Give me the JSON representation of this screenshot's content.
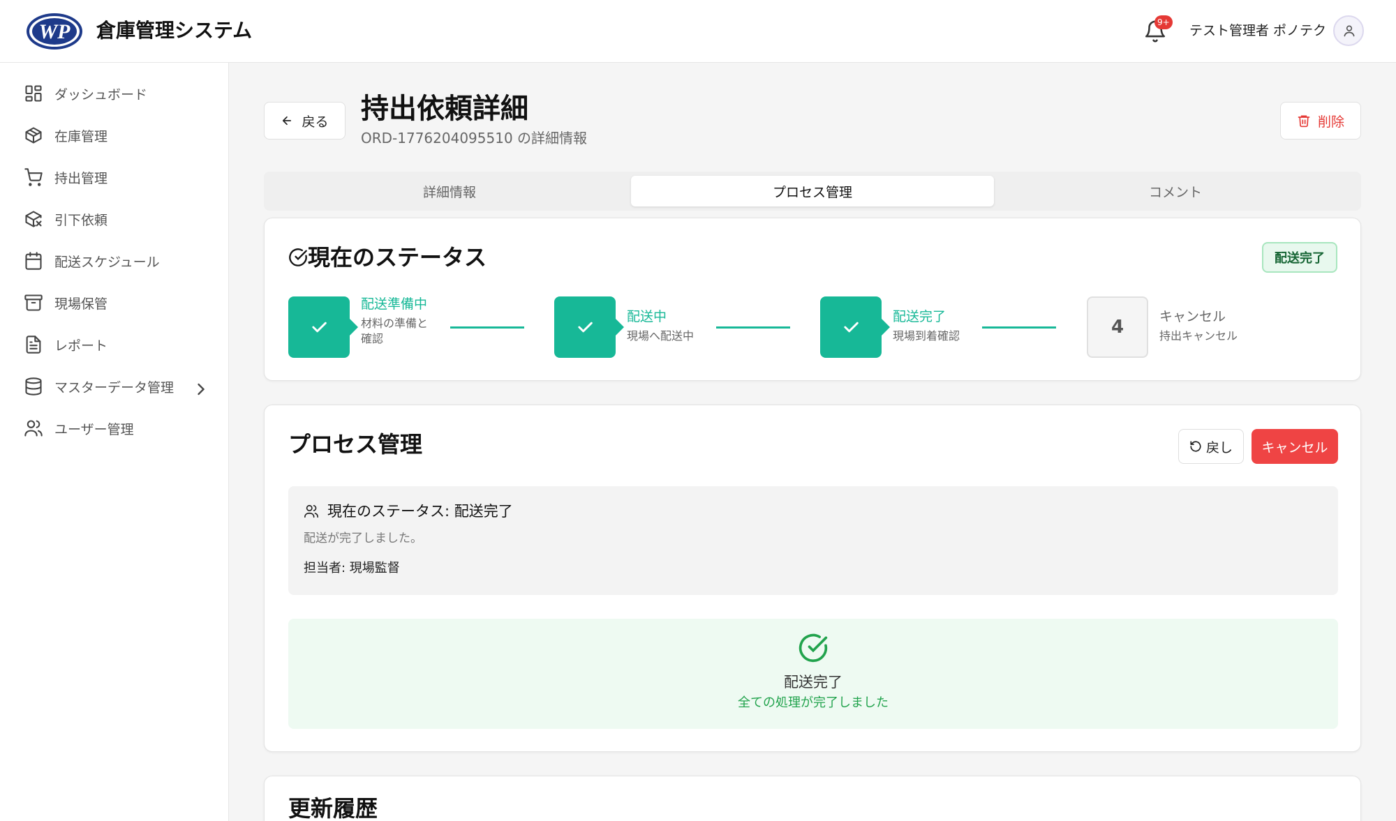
{
  "header": {
    "app_title": "倉庫管理システム",
    "notification_badge": "9+",
    "user_name": "テスト管理者 ポノテク"
  },
  "sidebar": {
    "items": [
      {
        "label": "ダッシュボード",
        "icon": "dashboard-icon"
      },
      {
        "label": "在庫管理",
        "icon": "box-icon"
      },
      {
        "label": "持出管理",
        "icon": "cart-icon"
      },
      {
        "label": "引下依頼",
        "icon": "package-return-icon"
      },
      {
        "label": "配送スケジュール",
        "icon": "calendar-icon"
      },
      {
        "label": "現場保管",
        "icon": "archive-icon"
      },
      {
        "label": "レポート",
        "icon": "document-icon"
      },
      {
        "label": "マスターデータ管理",
        "icon": "database-icon"
      },
      {
        "label": "ユーザー管理",
        "icon": "users-icon"
      }
    ]
  },
  "page": {
    "back_label": "戻る",
    "title": "持出依頼詳細",
    "subtitle": "ORD-1776204095510 の詳細情報",
    "delete_label": "削除"
  },
  "tabs": [
    {
      "label": "詳細情報",
      "active": false
    },
    {
      "label": "プロセス管理",
      "active": true
    },
    {
      "label": "コメント",
      "active": false
    }
  ],
  "status_card": {
    "title": "現在のステータス",
    "badge": "配送完了",
    "steps": [
      {
        "label": "配送準備中",
        "desc_line1": "材料の準備と",
        "desc_line2": "確認",
        "done": true
      },
      {
        "label": "配送中",
        "desc_line1": "現場へ配送中",
        "done": true
      },
      {
        "label": "配送完了",
        "desc_line1": "現場到着確認",
        "done": true
      },
      {
        "number": "4",
        "label": "キャンセル",
        "desc_line1": "持出キャンセル",
        "done": false
      }
    ]
  },
  "process_card": {
    "title": "プロセス管理",
    "undo_label": "戻し",
    "cancel_label": "キャンセル",
    "current_status": "現在のステータス: 配送完了",
    "message": "配送が完了しました。",
    "assignee": "担当者: 現場監督",
    "done_title": "配送完了",
    "done_subtitle": "全ての処理が完了しました"
  },
  "history_card": {
    "title": "更新履歴"
  },
  "colors": {
    "accent_teal": "#17b897",
    "danger": "#ef4444",
    "success_green": "#22a34d"
  }
}
